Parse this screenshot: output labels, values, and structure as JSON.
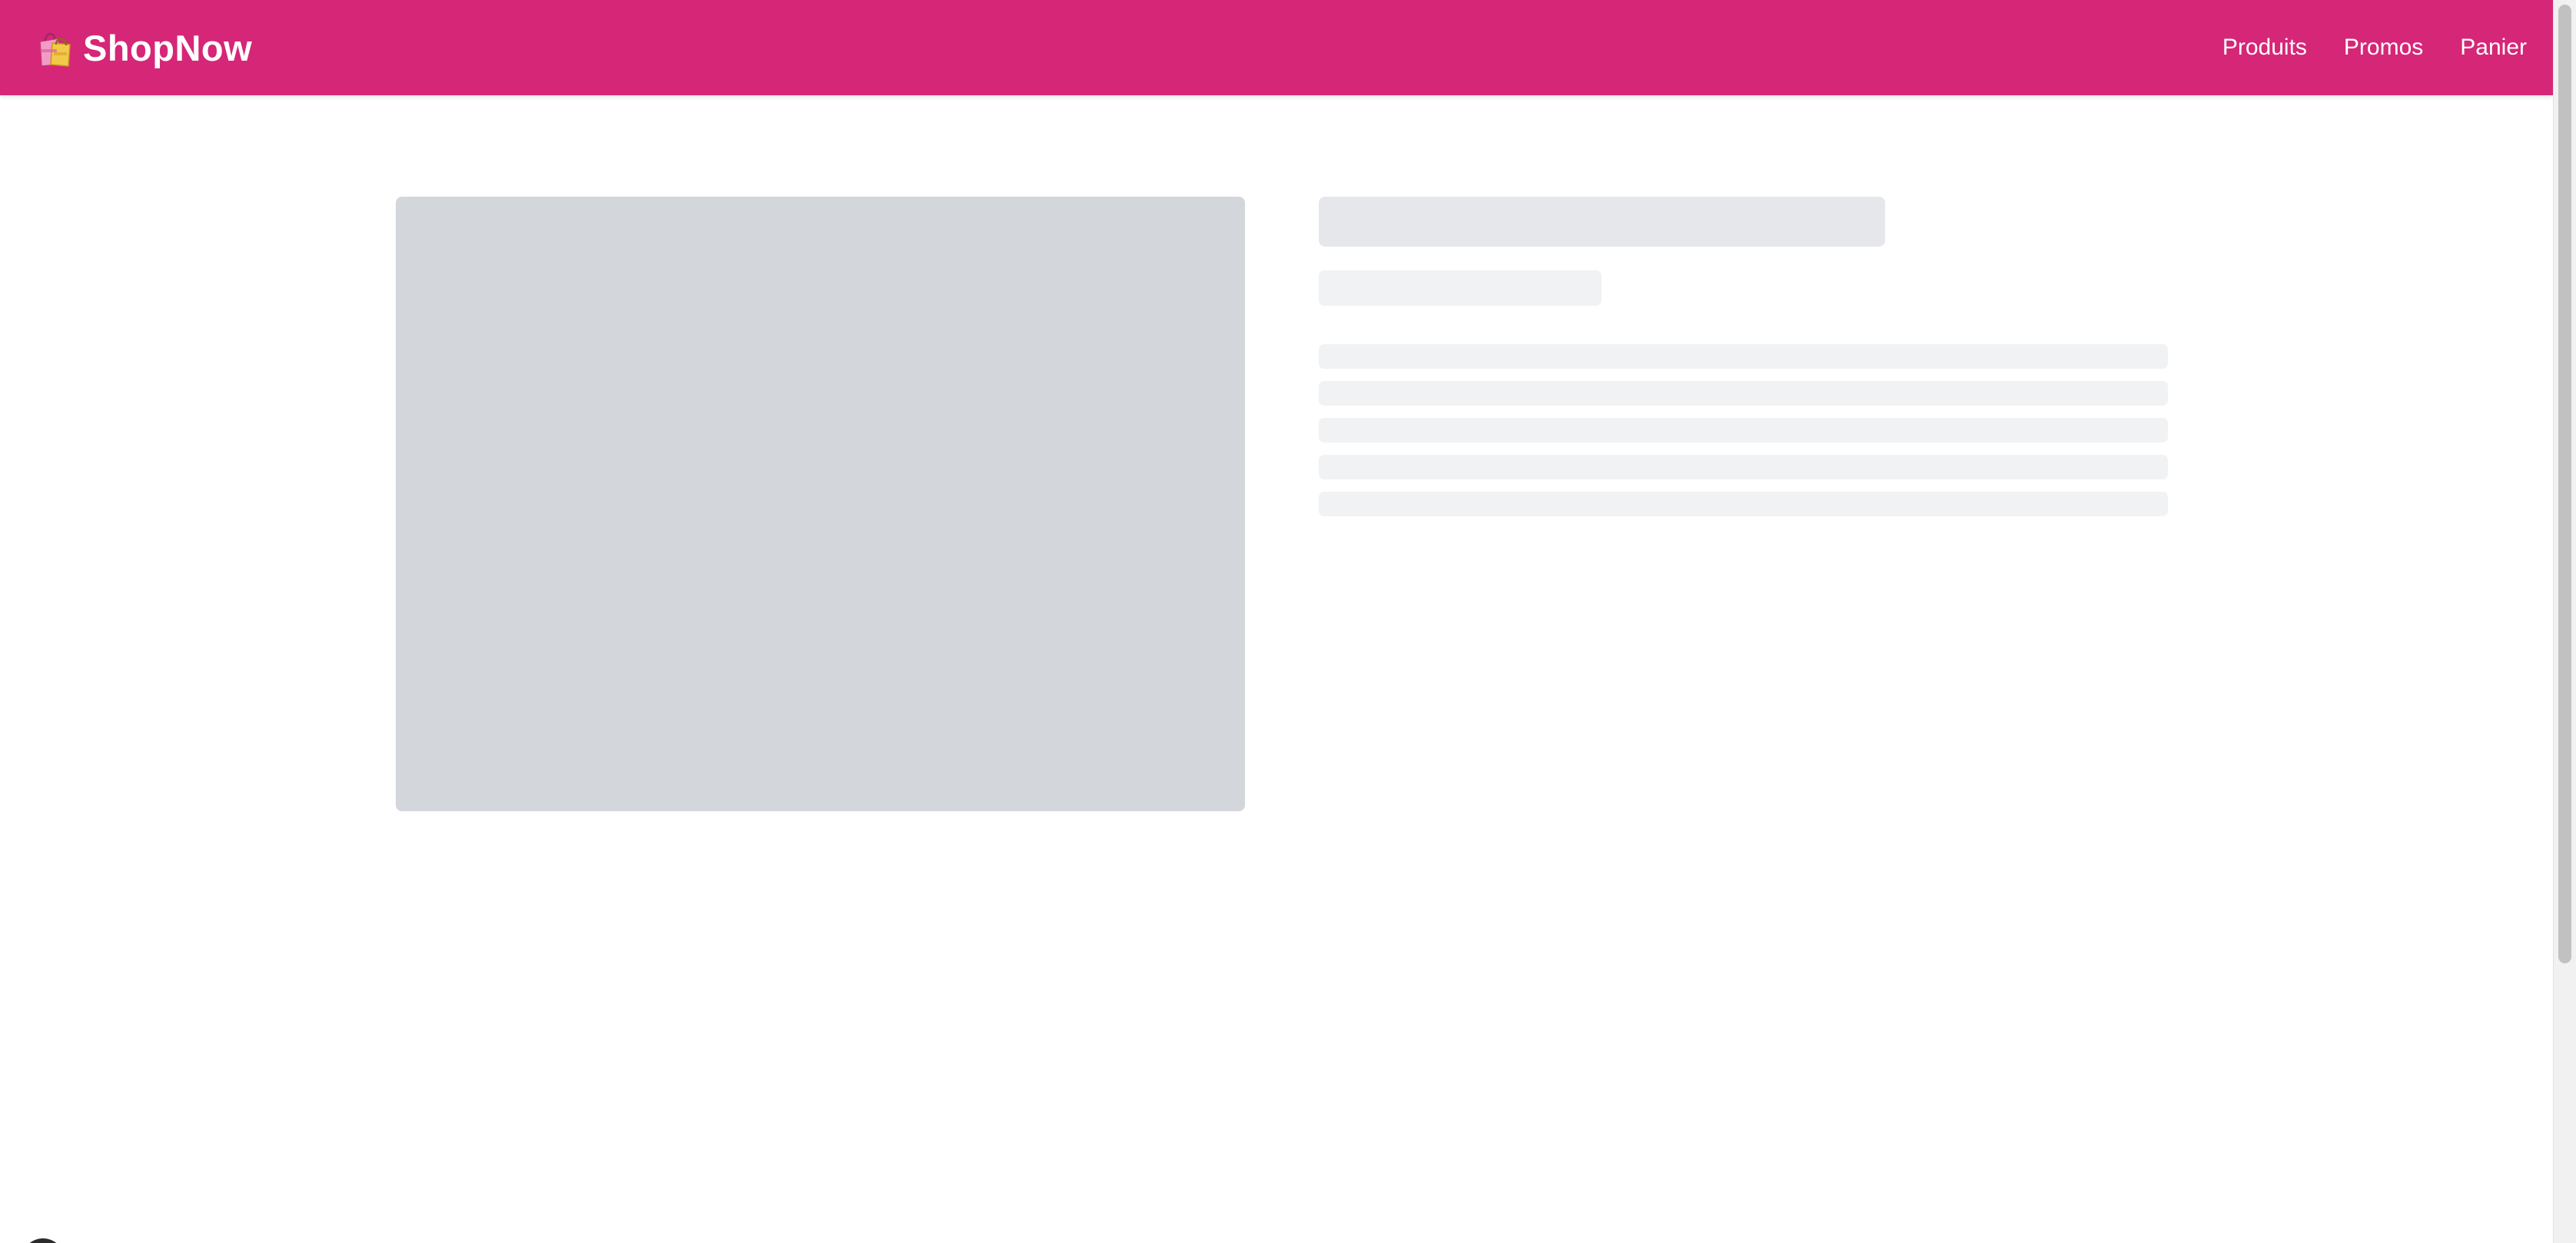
{
  "header": {
    "brand_icon": "shopping-bags-icon",
    "brand_name": "ShopNow",
    "background_color": "#d62677",
    "text_color": "#ffffff"
  },
  "nav": {
    "items": [
      {
        "label": "Produits"
      },
      {
        "label": "Promos"
      },
      {
        "label": "Panier"
      }
    ]
  },
  "product": {
    "state": "loading",
    "image_placeholder_color": "#d3d6da",
    "text_placeholder_color": "#f1f2f4",
    "title_placeholder_color": "#e5e7eb",
    "description_lines": 5
  },
  "floating_widget": {
    "icon": "chat-bubble-icon"
  }
}
